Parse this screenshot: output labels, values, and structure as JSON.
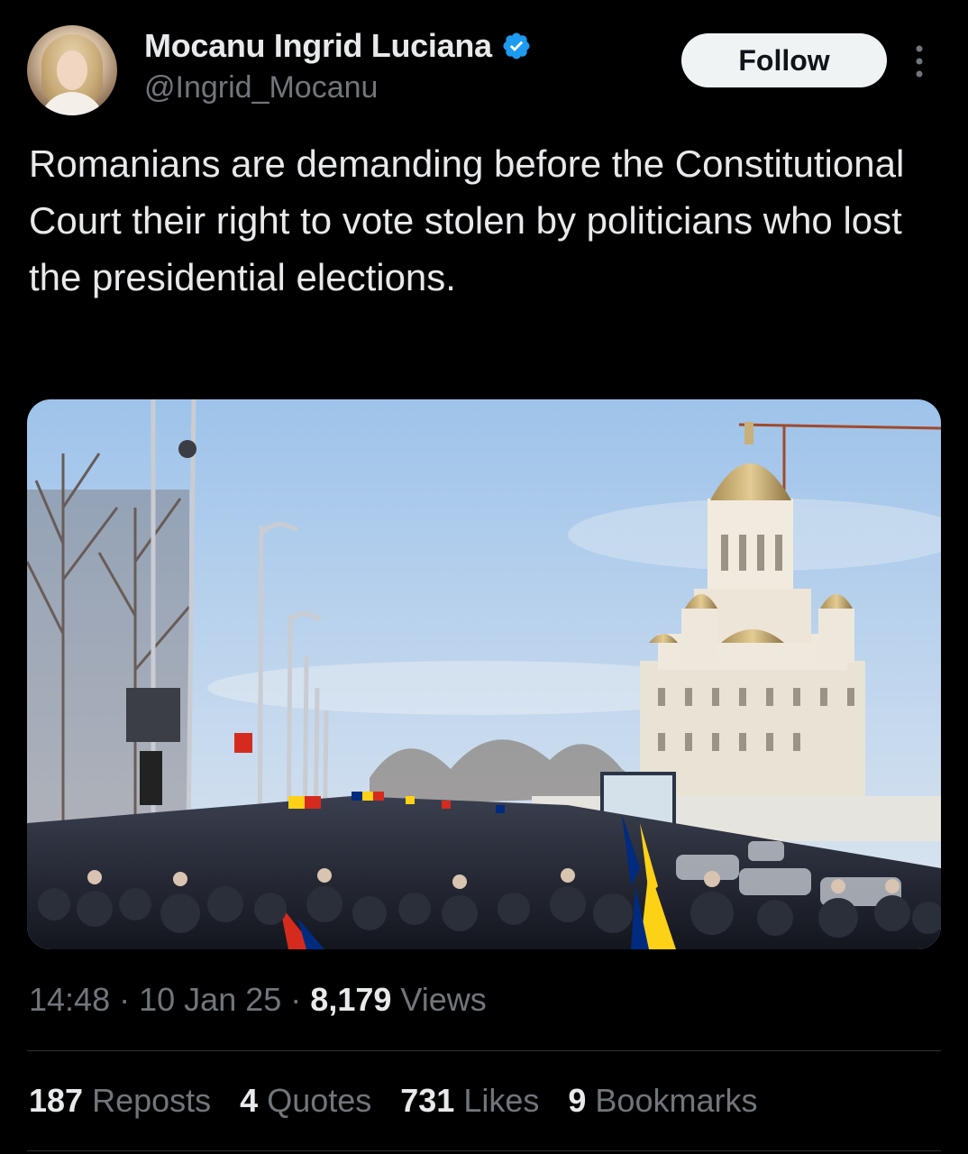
{
  "author": {
    "name": "Mocanu Ingrid Luciana",
    "handle": "@Ingrid_Mocanu",
    "verified_color": "#1d9bf0"
  },
  "follow_label": "Follow",
  "more_icon": "more-vertical-icon",
  "tweet": {
    "text": "Romanians are demanding before the Constitutional Court their right to vote stolen by politicians who lost the presidential elections."
  },
  "meta": {
    "time": "14:48",
    "date": "10 Jan 25",
    "views_count": "8,179",
    "views_label": "Views",
    "separator": "·"
  },
  "stats": {
    "reposts": {
      "count": "187",
      "label": "Reposts"
    },
    "quotes": {
      "count": "4",
      "label": "Quotes"
    },
    "likes": {
      "count": "731",
      "label": "Likes"
    },
    "bookmarks": {
      "count": "9",
      "label": "Bookmarks"
    }
  },
  "colors": {
    "background": "#000000",
    "text": "#e7e9ea",
    "secondary": "#71767b",
    "verified": "#1d9bf0"
  }
}
